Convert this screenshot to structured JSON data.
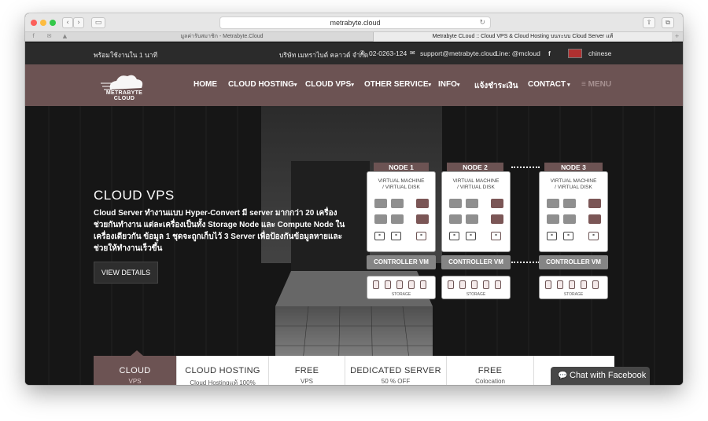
{
  "browser": {
    "url": "metrabyte.cloud",
    "tabs": [
      {
        "title": "มูลค่ารับสมาชิก - Metrabyte.Cloud"
      },
      {
        "title": "Metrabyte CLoud :: Cloud VPS & Cloud Hosting บนระบบ Cloud Server แท้"
      }
    ]
  },
  "topbar": {
    "tagline": "พร้อมใช้งานใน 1 นาที",
    "company": "บริษัท เมทราไบต์ คลาวด์ จำกัด",
    "phone": "02-0263-124",
    "email": "support@metrabyte.cloud",
    "line": "Line: @mcloud",
    "facebook": "f",
    "language": "chinese"
  },
  "header": {
    "logo_text_1": "METRABYTE",
    "logo_text_2": "CLOUD",
    "menu": [
      {
        "label": "HOME"
      },
      {
        "label": "CLOUD HOSTING"
      },
      {
        "label": "CLOUD VPS"
      },
      {
        "label": "OTHER SERVICE"
      },
      {
        "label": "INFO"
      },
      {
        "label": "แจ้งชำระเงิน"
      },
      {
        "label": "CONTACT"
      },
      {
        "label": "MENU"
      }
    ]
  },
  "hero": {
    "title": "CLOUD VPS",
    "description": "Cloud Server ทำงานแบบ Hyper-Convert มี server มากกว่า 20 เครื่องช่วยกันทำงาน แต่ละเครื่องเป็นทั้ง Storage Node และ Compute Node ในเครื่องเดียวกัน ข้อมูล 1 ชุดจะถูกเก็บไว้ 3 Server เพื่อป้องกันข้อมูลหายและช่วยให้ทำงานเร็วขึ้น",
    "button": "VIEW DETAILS"
  },
  "diagram": {
    "nodes": [
      {
        "name": "NODE 1",
        "vm_line1": "VIRTUAL MACHINE",
        "vm_line2": "/ VIRTUAL DISK",
        "controller": "CONTROLLER VM",
        "storage": "STORAGE"
      },
      {
        "name": "NODE 2",
        "vm_line1": "VIRTUAL MACHINE",
        "vm_line2": "/ VIRTUAL DISK",
        "controller": "CONTROLLER VM",
        "storage": "STORAGE"
      },
      {
        "name": "NODE 3",
        "vm_line1": "VIRTUAL MACHINE",
        "vm_line2": "/ VIRTUAL DISK",
        "controller": "CONTROLLER VM",
        "storage": "STORAGE"
      }
    ]
  },
  "bottom_tabs": [
    {
      "title": "CLOUD",
      "sub": "VPS"
    },
    {
      "title": "CLOUD HOSTING",
      "sub": "Cloud Hostingแท้ 100%"
    },
    {
      "title": "FREE",
      "sub": "VPS"
    },
    {
      "title": "DEDICATED SERVER",
      "sub": "50 % OFF"
    },
    {
      "title": "FREE",
      "sub": "Colocation"
    }
  ],
  "chat": {
    "label": "Chat with Facebook"
  },
  "colors": {
    "brand": "#6c5353",
    "topbar": "#2b2b2b"
  }
}
